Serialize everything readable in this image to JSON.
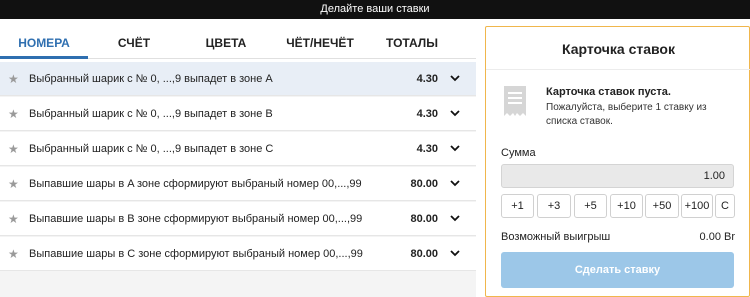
{
  "topbar": {
    "text": "Делайте ваши ставки"
  },
  "tabs": [
    {
      "label": "НОМЕРА"
    },
    {
      "label": "СЧЁТ"
    },
    {
      "label": "ЦВЕТА"
    },
    {
      "label": "ЧЁТ/НЕЧЁТ"
    },
    {
      "label": "ТОТАЛЫ"
    }
  ],
  "markets": [
    {
      "label": "Выбранный шарик с № 0, ...,9 выпадет в зоне A",
      "odds": "4.30"
    },
    {
      "label": "Выбранный шарик с № 0, ...,9 выпадет в зоне B",
      "odds": "4.30"
    },
    {
      "label": "Выбранный шарик с № 0, ...,9 выпадет в зоне C",
      "odds": "4.30"
    },
    {
      "label": "Выпавшие шары в A зоне сформируют выбраный номер 00,...,99",
      "odds": "80.00"
    },
    {
      "label": "Выпавшие шары в B зоне сформируют выбраный номер 00,...,99",
      "odds": "80.00"
    },
    {
      "label": "Выпавшие шары в C зоне сформируют выбраный номер 00,...,99",
      "odds": "80.00"
    }
  ],
  "betslip": {
    "title": "Карточка ставок",
    "empty_title": "Карточка ставок пуста.",
    "empty_text": "Пожалуйста, выберите 1 ставку из списка ставок.",
    "sum_label": "Сумма",
    "sum_value": "1.00",
    "quick_amounts": [
      "+1",
      "+3",
      "+5",
      "+10",
      "+50",
      "+100",
      "C"
    ],
    "win_label": "Возможный выигрыш",
    "win_value": "0.00 Br",
    "place_label": "Сделать ставку"
  },
  "colors": {
    "accent": "#2f6fb0",
    "card_border": "#f0b64c",
    "place_button": "#9cc7e8",
    "selected_row": "#e8eef6"
  },
  "icons": {
    "favorite": "star-icon",
    "expand": "chevron-down-icon",
    "empty_slip": "receipt-icon"
  }
}
